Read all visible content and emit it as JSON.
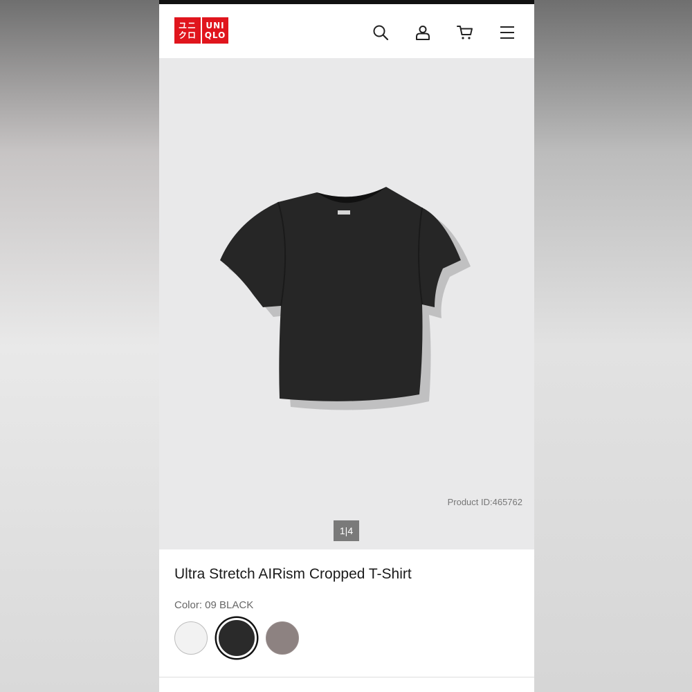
{
  "brand": {
    "logo_left_lines": [
      "ユニ",
      "クロ"
    ],
    "logo_right_lines": [
      "UNI",
      "QLO"
    ],
    "color": "#e0151d"
  },
  "header": {
    "icons": [
      "search-icon",
      "account-icon",
      "cart-icon",
      "menu-icon"
    ]
  },
  "gallery": {
    "product_id": "Product ID:465762",
    "pager": "1|4",
    "background": "#e9e9ea"
  },
  "product": {
    "title": "Ultra Stretch AIRism Cropped T-Shirt",
    "color_label": "Color: 09 BLACK",
    "swatches": [
      {
        "name": "white",
        "hex": "#f2f2f2",
        "selected": false
      },
      {
        "name": "black",
        "hex": "#2a2a2a",
        "selected": true
      },
      {
        "name": "gray",
        "hex": "#8d8281",
        "selected": false
      }
    ]
  }
}
